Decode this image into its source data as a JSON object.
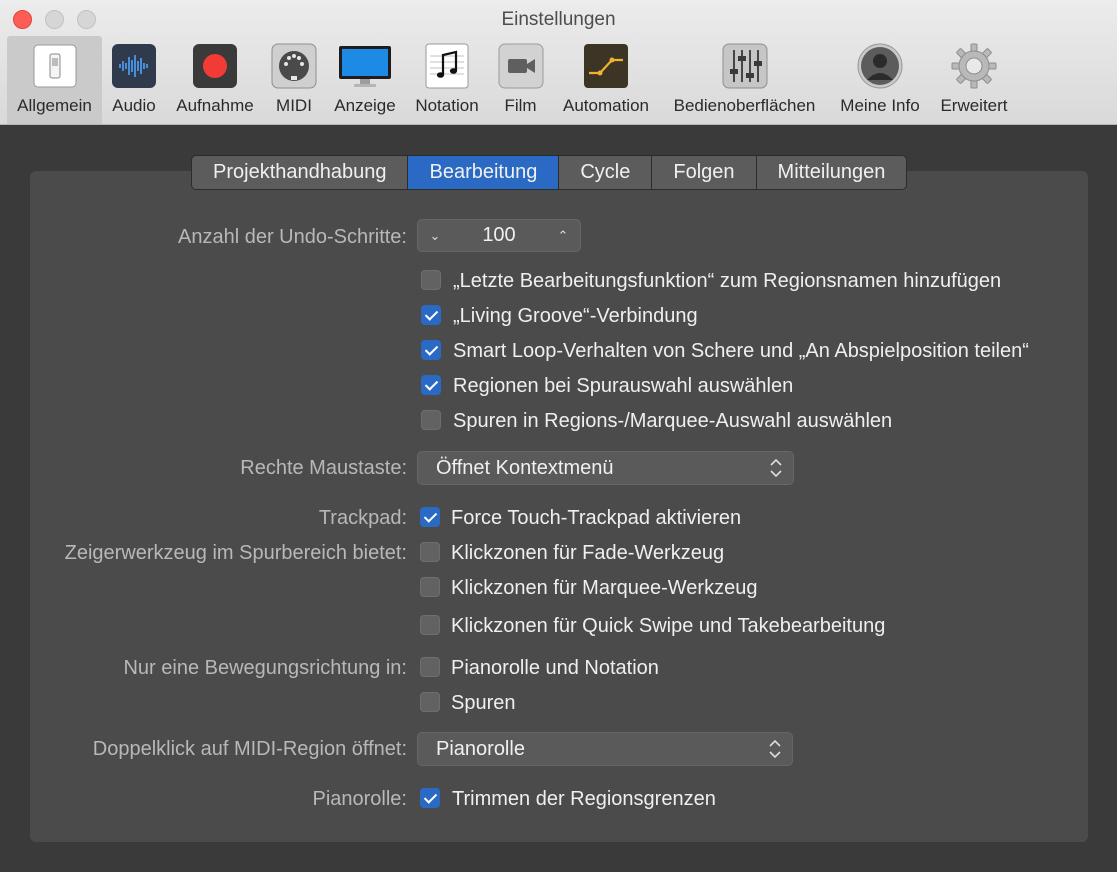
{
  "window": {
    "title": "Einstellungen"
  },
  "toolbar": {
    "items": [
      {
        "label": "Allgemein",
        "icon": "switch-icon",
        "selected": true
      },
      {
        "label": "Audio",
        "icon": "waveform-icon"
      },
      {
        "label": "Aufnahme",
        "icon": "record-icon"
      },
      {
        "label": "MIDI",
        "icon": "midi-plug-icon"
      },
      {
        "label": "Anzeige",
        "icon": "display-icon"
      },
      {
        "label": "Notation",
        "icon": "music-note-icon"
      },
      {
        "label": "Film",
        "icon": "video-camera-icon"
      },
      {
        "label": "Automation",
        "icon": "automation-icon"
      },
      {
        "label": "Bedienoberflächen",
        "icon": "faders-icon"
      },
      {
        "label": "Meine Info",
        "icon": "user-icon"
      },
      {
        "label": "Erweitert",
        "icon": "gear-icon"
      }
    ]
  },
  "tabs": [
    {
      "label": "Projekthandhabung",
      "active": false
    },
    {
      "label": "Bearbeitung",
      "active": true
    },
    {
      "label": "Cycle",
      "active": false
    },
    {
      "label": "Folgen",
      "active": false
    },
    {
      "label": "Mitteilungen",
      "active": false
    }
  ],
  "settings": {
    "undo_label": "Anzahl der Undo-Schritte:",
    "undo_value": "100",
    "checks": [
      {
        "label": "„Letzte Bearbeitungsfunktion“ zum Regionsnamen hinzufügen",
        "checked": false
      },
      {
        "label": "„Living Groove“-Verbindung",
        "checked": true
      },
      {
        "label": "Smart Loop-Verhalten von Schere und „An Abspielposition teilen“",
        "checked": true
      },
      {
        "label": "Regionen bei Spurauswahl auswählen",
        "checked": true
      },
      {
        "label": "Spuren in Regions-/Marquee-Auswahl auswählen",
        "checked": false
      }
    ],
    "right_mouse_label": "Rechte Maustaste:",
    "right_mouse_value": "Öffnet Kontextmenü",
    "trackpad_label": "Trackpad:",
    "trackpad": {
      "label": "Force Touch-Trackpad aktivieren",
      "checked": true
    },
    "pointer_label": "Zeigerwerkzeug im Spurbereich bietet:",
    "pointer_checks": [
      {
        "label": "Klickzonen für Fade-Werkzeug",
        "checked": false
      },
      {
        "label": "Klickzonen für Marquee-Werkzeug",
        "checked": false
      },
      {
        "label": "Klickzonen für Quick Swipe und Takebearbeitung",
        "checked": false
      }
    ],
    "direction_label": "Nur eine Bewegungsrichtung in:",
    "direction_checks": [
      {
        "label": "Pianorolle und Notation",
        "checked": false
      },
      {
        "label": "Spuren",
        "checked": false
      }
    ],
    "doubleclick_label": "Doppelklick auf MIDI-Region öffnet:",
    "doubleclick_value": "Pianorolle",
    "pianoroll_label": "Pianorolle:",
    "pianoroll": {
      "label": "Trimmen der Regionsgrenzen",
      "checked": true
    }
  },
  "colors": {
    "accent": "#2a6ac4",
    "record": "#f23b35"
  }
}
